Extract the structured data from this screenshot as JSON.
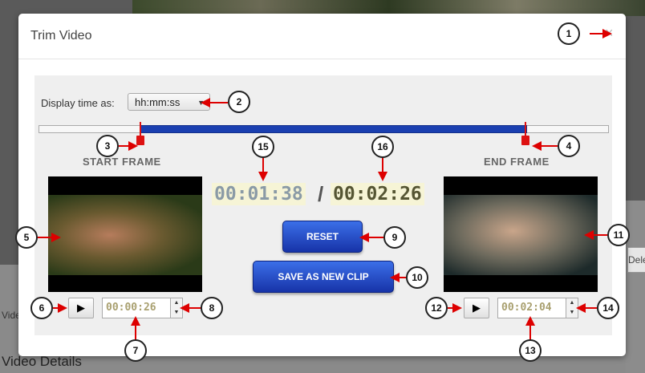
{
  "background": {
    "video_label": "Vide",
    "details_label": "Video Details",
    "side_button": "Delet"
  },
  "modal": {
    "title": "Trim Video",
    "close_glyph": "×",
    "display_label": "Display time as:",
    "time_format": "hh:mm:ss",
    "start_label": "START FRAME",
    "end_label": "END FRAME",
    "current_time": "00:01:38",
    "separator": "/",
    "total_time": "00:02:26",
    "reset_label": "RESET",
    "save_label": "SAVE AS NEW CLIP",
    "start_time": "00:00:26",
    "end_time": "00:02:04"
  },
  "callouts": [
    "1",
    "2",
    "3",
    "4",
    "5",
    "6",
    "7",
    "8",
    "9",
    "10",
    "11",
    "12",
    "13",
    "14",
    "15",
    "16"
  ],
  "colors": {
    "accent": "#1a3fb0",
    "marker": "#dd1111",
    "time_highlight": "#f6f4d6"
  }
}
